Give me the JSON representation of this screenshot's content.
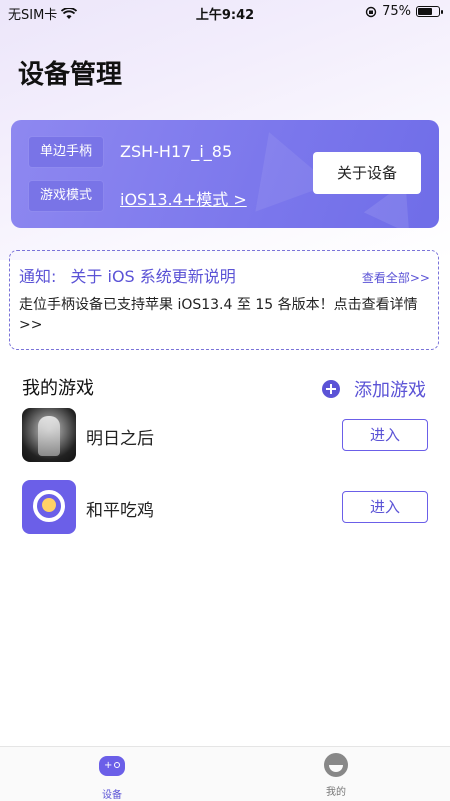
{
  "status_bar": {
    "carrier": "无SIM卡",
    "time": "上午9:42",
    "battery_percent": "75%",
    "battery_level": 0.75
  },
  "page_title": "设备管理",
  "device": {
    "handle_label": "单边手柄",
    "handle_value": "ZSH-H17_i_85",
    "mode_label": "游戏模式",
    "mode_value": "iOS13.4+模式 >",
    "about_button": "关于设备"
  },
  "notice": {
    "prefix": "通知:",
    "title": "关于 iOS 系统更新说明",
    "view_all": "查看全部>>",
    "body": "走位手柄设备已支持苹果 iOS13.4 至 15 各版本！点击查看详情>>"
  },
  "games": {
    "section_title": "我的游戏",
    "add_label": "添加游戏",
    "items": [
      {
        "name": "明日之后",
        "enter": "进入"
      },
      {
        "name": "和平吃鸡",
        "enter": "进入"
      }
    ]
  },
  "tabbar": {
    "tabs": [
      {
        "label": "设备",
        "active": true
      },
      {
        "label": "我的",
        "active": false
      }
    ]
  },
  "colors": {
    "accent": "#5b53d6",
    "card": "#7b77ec"
  }
}
